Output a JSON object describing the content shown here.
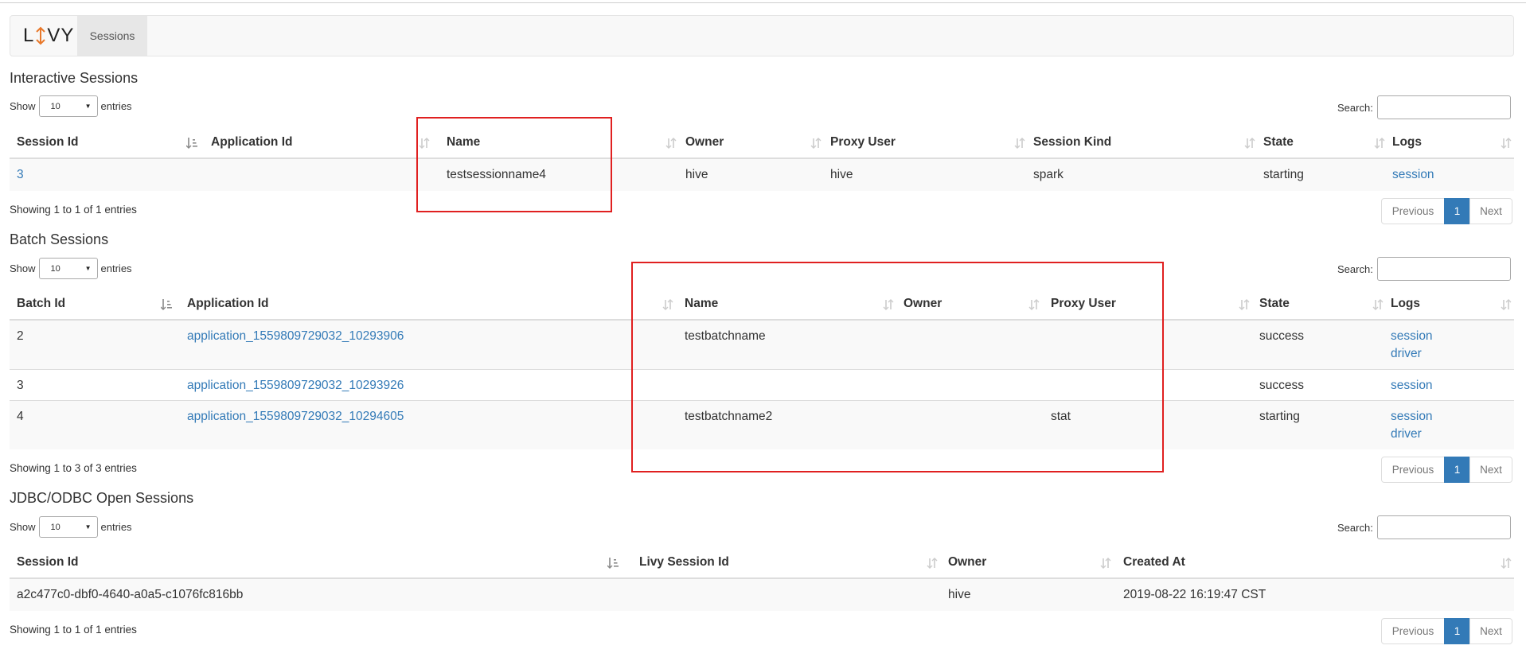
{
  "brand": {
    "text_left": "L",
    "text_right": "VY"
  },
  "nav": {
    "sessions_tab": "Sessions"
  },
  "common": {
    "show": "Show",
    "entries": "entries",
    "page_size": "10",
    "search_label": "Search:",
    "previous": "Previous",
    "page_number": "1",
    "next": "Next"
  },
  "interactive": {
    "title": "Interactive Sessions",
    "headers": [
      "Session Id",
      "Application Id",
      "Name",
      "Owner",
      "Proxy User",
      "Session Kind",
      "State",
      "Logs"
    ],
    "rows": [
      {
        "session_id": "3",
        "application_id": "",
        "name": "testsessionname4",
        "owner": "hive",
        "proxy_user": "hive",
        "session_kind": "spark",
        "state": "starting",
        "logs": [
          "session"
        ]
      }
    ],
    "info": "Showing 1 to 1 of 1 entries"
  },
  "batch": {
    "title": "Batch Sessions",
    "headers": [
      "Batch Id",
      "Application Id",
      "Name",
      "Owner",
      "Proxy User",
      "State",
      "Logs"
    ],
    "rows": [
      {
        "batch_id": "2",
        "application_id": "application_1559809729032_10293906",
        "name": "testbatchname",
        "owner": "",
        "proxy_user": "",
        "state": "success",
        "logs": [
          "session",
          "driver"
        ]
      },
      {
        "batch_id": "3",
        "application_id": "application_1559809729032_10293926",
        "name": "",
        "owner": "",
        "proxy_user": "",
        "state": "success",
        "logs": [
          "session"
        ]
      },
      {
        "batch_id": "4",
        "application_id": "application_1559809729032_10294605",
        "name": "testbatchname2",
        "owner": "",
        "proxy_user": "stat",
        "state": "starting",
        "logs": [
          "session",
          "driver"
        ]
      }
    ],
    "info": "Showing 1 to 3 of 3 entries"
  },
  "jdbc": {
    "title": "JDBC/ODBC Open Sessions",
    "headers": [
      "Session Id",
      "Livy Session Id",
      "Owner",
      "Created At"
    ],
    "rows": [
      {
        "session_id": "a2c477c0-dbf0-4640-a0a5-c1076fc816bb",
        "livy_session_id": "",
        "owner": "hive",
        "created_at": "2019-08-22 16:19:47 CST"
      }
    ],
    "info": "Showing 1 to 1 of 1 entries"
  },
  "colors": {
    "link": "#337ab7",
    "highlight_box": "#e02020",
    "brand_arrow": "#e8782a"
  },
  "icons": {
    "sort_both": "sort-icon",
    "sort_asc": "sort-ascending-icon",
    "select_caret": "caret-down-icon",
    "brand_arrow": "up-down-arrow-icon"
  }
}
